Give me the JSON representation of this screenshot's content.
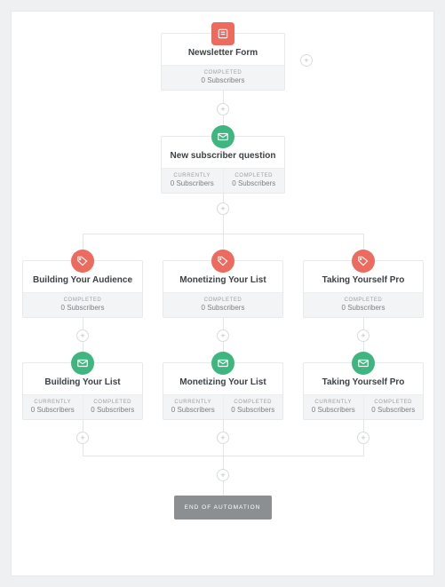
{
  "colors": {
    "red": "#ed6a5e",
    "green": "#3fb67f",
    "end": "#8b8f92"
  },
  "end_label": "END OF AUTOMATION",
  "add_glyph": "+",
  "nodes": {
    "newsletter": {
      "title": "Newsletter Form",
      "icon": "form-icon",
      "color": "red",
      "stats": [
        {
          "label": "COMPLETED",
          "value": "0 Subscribers"
        }
      ]
    },
    "question": {
      "title": "New subscriber question",
      "icon": "mail-icon",
      "color": "green",
      "stats": [
        {
          "label": "CURRENTLY",
          "value": "0 Subscribers"
        },
        {
          "label": "COMPLETED",
          "value": "0 Subscribers"
        }
      ]
    },
    "row2": [
      {
        "title": "Building Your Audience",
        "icon": "tag-icon",
        "color": "red",
        "stats": [
          {
            "label": "COMPLETED",
            "value": "0 Subscribers"
          }
        ]
      },
      {
        "title": "Monetizing Your List",
        "icon": "tag-icon",
        "color": "red",
        "stats": [
          {
            "label": "COMPLETED",
            "value": "0 Subscribers"
          }
        ]
      },
      {
        "title": "Taking Yourself Pro",
        "icon": "tag-icon",
        "color": "red",
        "stats": [
          {
            "label": "COMPLETED",
            "value": "0 Subscribers"
          }
        ]
      }
    ],
    "row3": [
      {
        "title": "Building Your List",
        "icon": "mail-icon",
        "color": "green",
        "stats": [
          {
            "label": "CURRENTLY",
            "value": "0 Subscribers"
          },
          {
            "label": "COMPLETED",
            "value": "0 Subscribers"
          }
        ]
      },
      {
        "title": "Monetizing Your List",
        "icon": "mail-icon",
        "color": "green",
        "stats": [
          {
            "label": "CURRENTLY",
            "value": "0 Subscribers"
          },
          {
            "label": "COMPLETED",
            "value": "0 Subscribers"
          }
        ]
      },
      {
        "title": "Taking Yourself Pro",
        "icon": "mail-icon",
        "color": "green",
        "stats": [
          {
            "label": "CURRENTLY",
            "value": "0 Subscribers"
          },
          {
            "label": "COMPLETED",
            "value": "0 Subscribers"
          }
        ]
      }
    ]
  }
}
